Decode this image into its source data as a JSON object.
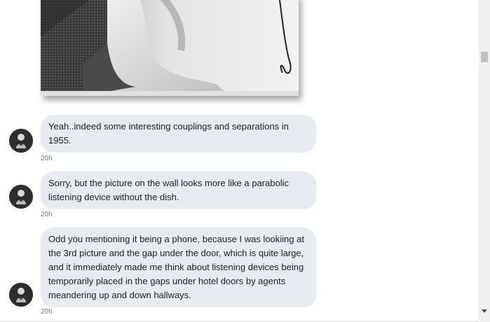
{
  "messages": [
    {
      "text": "Yeah..indeed some interesting couplings and separations in 1955.",
      "time": "20h",
      "avatar_icon": "user-avatar-icon"
    },
    {
      "text": "Sorry, but the picture on the wall looks more like a parabolic listening device without the dish.",
      "time": "20h",
      "avatar_icon": "user-avatar-icon"
    },
    {
      "text": "Odd you mentioning it being a phone, because I was lookiing at the 3rd picture and the gap under the door, which is quite large, and it immediately made me think about listening devices being temporarily placed in the gaps under hotel doors by agents meandering up and down hallways.",
      "time": "20h",
      "avatar_icon": "user-avatar-icon"
    }
  ],
  "colors": {
    "bubble_bg": "#e7ebf0",
    "text": "#1c1e21",
    "timestamp": "#7a7a7a",
    "scrollbar_track": "#f0f0f0",
    "scrollbar_thumb": "#c1c1c1"
  }
}
